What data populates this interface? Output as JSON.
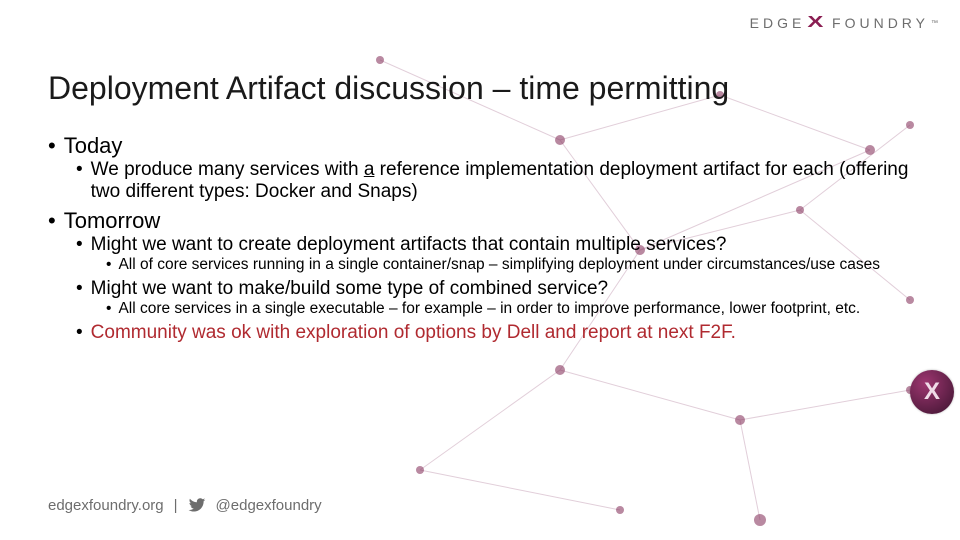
{
  "logo": {
    "left": "EDGE",
    "right": "FOUNDRY",
    "x": "X",
    "tm": "™"
  },
  "badge": {
    "glyph": "X"
  },
  "title": "Deployment Artifact discussion – time permitting",
  "bullets": {
    "l1a": "Today",
    "l2a_pre": "We produce many services with ",
    "l2a_u": "a",
    "l2a_post": " reference implementation deployment artifact for each (offering two different types:  Docker and Snaps)",
    "l1b": "Tomorrow",
    "l2b": "Might we want to create deployment artifacts that contain multiple services?",
    "l3b": "All of core services running in a single container/snap – simplifying deployment under circumstances/use cases",
    "l2c": "Might we want to make/build some type of combined service?",
    "l3c": "All core services in a single executable – for example – in order to improve performance, lower footprint, etc.",
    "l2d": "Community was ok with exploration of options by Dell and report at next F2F."
  },
  "footer": {
    "url": "edgexfoundry.org",
    "divider": "|",
    "handle": "@edgexfoundry"
  },
  "colors": {
    "accent": "#8a1e52",
    "red": "#b02a30",
    "muted": "#6d6d6d"
  }
}
